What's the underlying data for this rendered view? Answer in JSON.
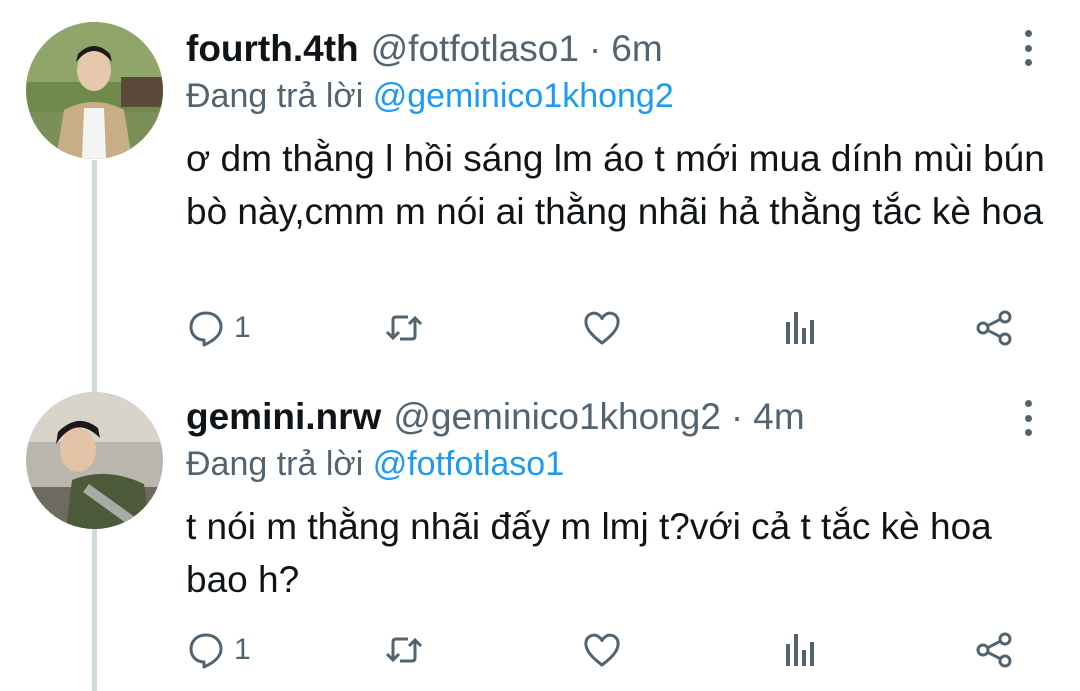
{
  "tweets": [
    {
      "name": "fourth.4th",
      "handle": "@fotfotlaso1",
      "dot": "·",
      "time": "6m",
      "replying_prefix": "Đang trả lời",
      "replying_to": "@geminico1khong2",
      "text": "ơ dm thằng l hồi sáng lm áo t mới mua dính mùi bún bò này,cmm m nói ai thằng nhãi hả thằng tắc kè hoa",
      "reply_count": "1",
      "avatar_icon": "avatar-photo"
    },
    {
      "name": "gemini.nrw",
      "handle": "@geminico1khong2",
      "dot": "·",
      "time": "4m",
      "replying_prefix": "Đang trả lời",
      "replying_to": "@fotfotlaso1",
      "text": "t nói m thằng nhãi đấy m lmj t?với cả t tắc kè hoa bao h?",
      "reply_count": "1",
      "avatar_icon": "avatar-photo"
    }
  ],
  "icons": {
    "reply": "reply-icon",
    "retweet": "retweet-icon",
    "like": "heart-icon",
    "views": "views-icon",
    "share": "share-icon",
    "more": "more-vertical-icon"
  },
  "colors": {
    "text": "#0f1419",
    "secondary": "#536471",
    "link": "#1d9bf0",
    "thread_line": "#cfd9de"
  }
}
